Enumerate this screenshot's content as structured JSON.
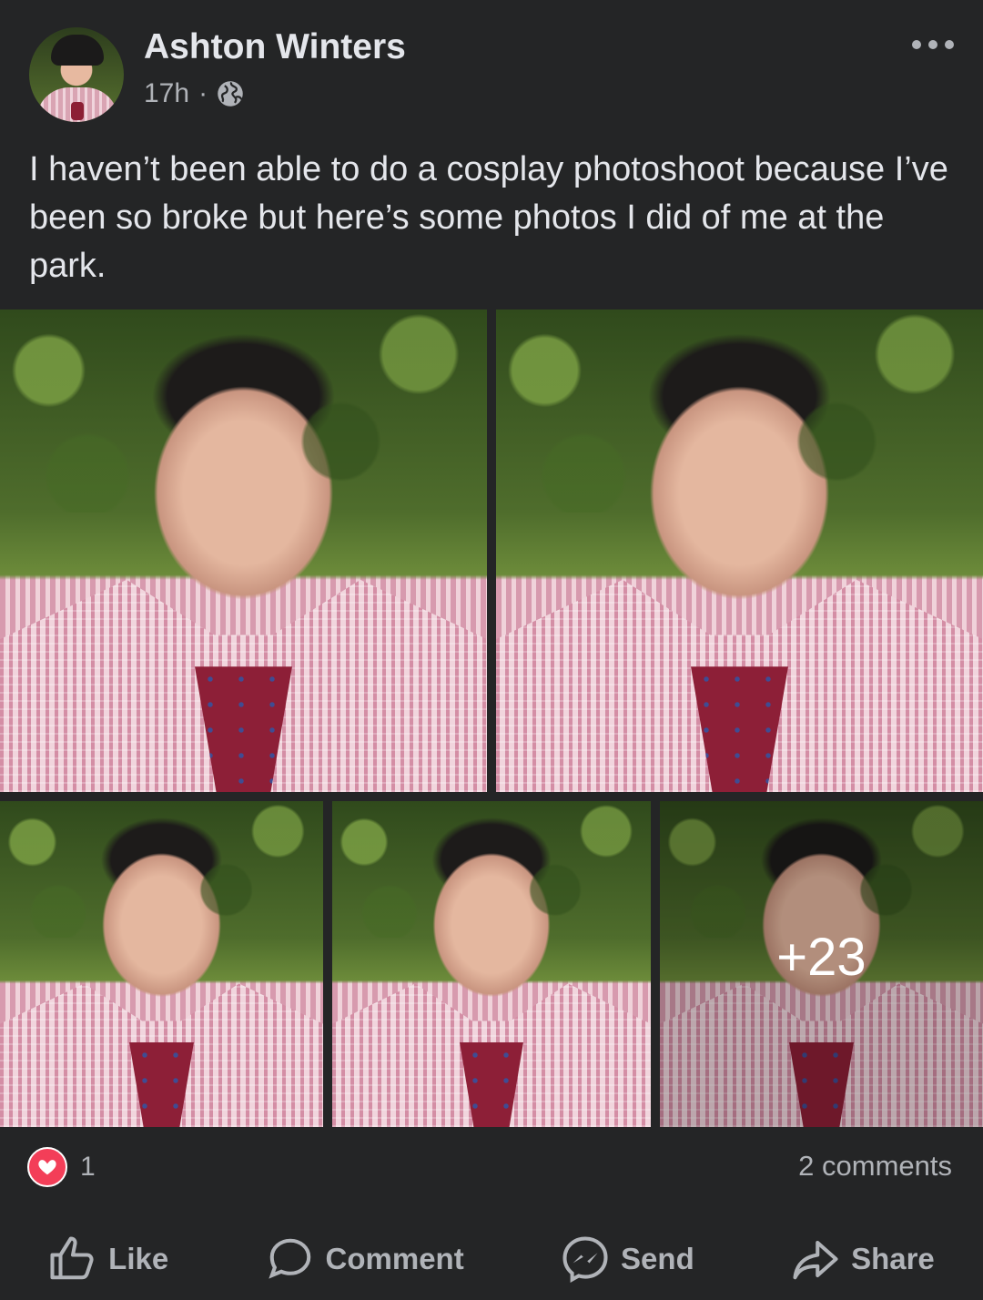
{
  "post": {
    "author": "Ashton Winters",
    "time": "17h",
    "separator": "·",
    "caption": "I haven’t been able to do a cosplay photoshoot because I’ve been so broke but here’s some photos I did of me at the park.",
    "icons": {
      "privacy": "globe-icon",
      "menu": "more-options-icon"
    }
  },
  "gallery": {
    "photo_count": 5,
    "more_label": "+23"
  },
  "reactions": {
    "type": "love",
    "count": "1",
    "comments": "2 comments",
    "color": "#f33e58"
  },
  "actions": {
    "like": "Like",
    "comment": "Comment",
    "send": "Send",
    "share": "Share"
  }
}
